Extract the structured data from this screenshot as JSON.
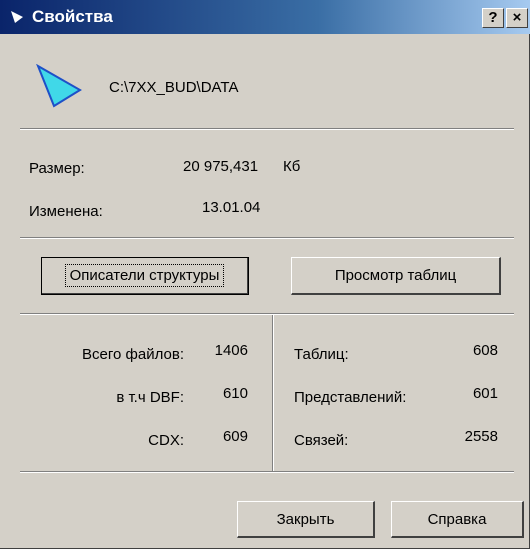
{
  "window": {
    "title": "Свойства",
    "help_button": "?",
    "close_button": "×"
  },
  "header": {
    "path": "C:\\7XX_BUD\\DATA",
    "icon": "folder-arrow-icon"
  },
  "info": {
    "size_label": "Размер:",
    "size_value": "20 975,431",
    "size_unit": "Кб",
    "modified_label": "Изменена:",
    "modified_value": "13.01.04"
  },
  "buttons": {
    "describers": "Описатели структуры",
    "view_tables": "Просмотр таблиц",
    "close": "Закрыть",
    "help": "Справка"
  },
  "stats_left": [
    {
      "label": "Всего файлов:",
      "value": "1406"
    },
    {
      "label": "в т.ч DBF:",
      "value": "610"
    },
    {
      "label": "CDX:",
      "value": "609"
    }
  ],
  "stats_right": [
    {
      "label": "Таблиц:",
      "value": "608"
    },
    {
      "label": "Представлений:",
      "value": "601"
    },
    {
      "label": "Связей:",
      "value": "2558"
    }
  ],
  "colors": {
    "title_start": "#0a246a",
    "title_end": "#a6caf0",
    "face": "#d4d0c8",
    "icon_cyan": "#40d8e8",
    "icon_blue": "#1e50c8"
  }
}
